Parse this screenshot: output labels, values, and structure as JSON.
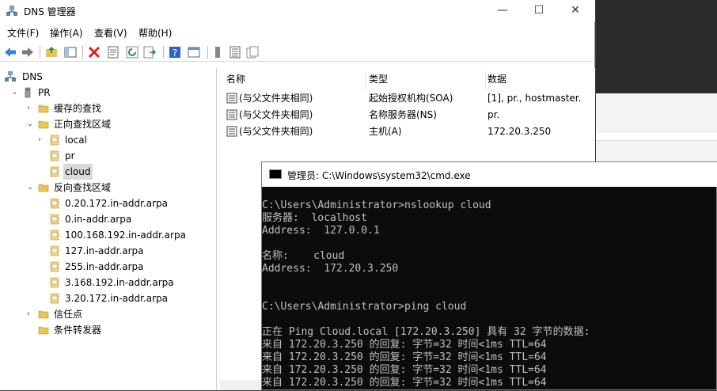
{
  "dns_window": {
    "title": "DNS 管理器",
    "menu": [
      "文件(F)",
      "操作(A)",
      "查看(V)",
      "帮助(H)"
    ],
    "controls": {
      "minimize": "—",
      "maximize": "☐",
      "close": "✕"
    }
  },
  "tree": [
    {
      "label": "DNS",
      "level": 0,
      "arrow": "",
      "icon": "dns-icon"
    },
    {
      "label": "PR",
      "level": 1,
      "arrow": "⌄",
      "icon": "server-icon"
    },
    {
      "label": "缓存的查找",
      "level": 2,
      "arrow": "›",
      "icon": "folder-icon"
    },
    {
      "label": "正向查找区域",
      "level": 2,
      "arrow": "⌄",
      "icon": "folder-icon"
    },
    {
      "label": "local",
      "level": 3,
      "arrow": "›",
      "icon": "zone-icon"
    },
    {
      "label": "pr",
      "level": 3,
      "arrow": "",
      "icon": "zone-icon"
    },
    {
      "label": "cloud",
      "level": 3,
      "arrow": "",
      "icon": "zone-icon",
      "selected": true
    },
    {
      "label": "反向查找区域",
      "level": 2,
      "arrow": "⌄",
      "icon": "folder-icon"
    },
    {
      "label": "0.20.172.in-addr.arpa",
      "level": 3,
      "arrow": "",
      "icon": "zone-icon"
    },
    {
      "label": "0.in-addr.arpa",
      "level": 3,
      "arrow": "",
      "icon": "zone-icon"
    },
    {
      "label": "100.168.192.in-addr.arpa",
      "level": 3,
      "arrow": "",
      "icon": "zone-icon"
    },
    {
      "label": "127.in-addr.arpa",
      "level": 3,
      "arrow": "",
      "icon": "zone-icon"
    },
    {
      "label": "255.in-addr.arpa",
      "level": 3,
      "arrow": "",
      "icon": "zone-icon"
    },
    {
      "label": "3.168.192.in-addr.arpa",
      "level": 3,
      "arrow": "",
      "icon": "zone-icon"
    },
    {
      "label": "3.20.172.in-addr.arpa",
      "level": 3,
      "arrow": "",
      "icon": "zone-icon"
    },
    {
      "label": "信任点",
      "level": 2,
      "arrow": "›",
      "icon": "folder-icon"
    },
    {
      "label": "条件转发器",
      "level": 2,
      "arrow": "",
      "icon": "folder-icon"
    }
  ],
  "list": {
    "columns": [
      "名称",
      "类型",
      "数据"
    ],
    "rows": [
      [
        "(与父文件夹相同)",
        "起始授权机构(SOA)",
        "[1], pr., hostmaster."
      ],
      [
        "(与父文件夹相同)",
        "名称服务器(NS)",
        "pr."
      ],
      [
        "(与父文件夹相同)",
        "主机(A)",
        "172.20.3.250"
      ]
    ]
  },
  "cmd": {
    "title": "管理员: C:\\Windows\\system32\\cmd.exe",
    "lines": [
      "C:\\Users\\Administrator>nslookup cloud",
      "服务器:  localhost",
      "Address:  127.0.0.1",
      "",
      "名称:    cloud",
      "Address:  172.20.3.250",
      "",
      "",
      "C:\\Users\\Administrator>ping cloud",
      "",
      "正在 Ping Cloud.local [172.20.3.250] 具有 32 字节的数据:",
      "来自 172.20.3.250 的回复: 字节=32 时间<1ms TTL=64",
      "来自 172.20.3.250 的回复: 字节=32 时间<1ms TTL=64",
      "来自 172.20.3.250 的回复: 字节=32 时间<1ms TTL=64",
      "来自 172.20.3.250 的回复: 字节=32 时间<1ms TTL=64"
    ]
  }
}
